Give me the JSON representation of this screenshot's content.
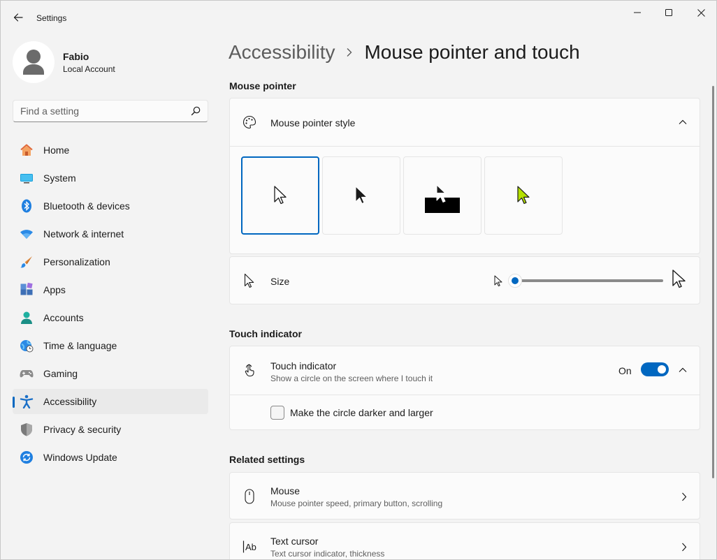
{
  "app": {
    "title": "Settings"
  },
  "profile": {
    "name": "Fabio",
    "account_type": "Local Account"
  },
  "search": {
    "placeholder": "Find a setting"
  },
  "sidebar": {
    "items": [
      {
        "label": "Home",
        "icon": "home-icon"
      },
      {
        "label": "System",
        "icon": "system-icon"
      },
      {
        "label": "Bluetooth & devices",
        "icon": "bluetooth-icon"
      },
      {
        "label": "Network & internet",
        "icon": "wifi-icon"
      },
      {
        "label": "Personalization",
        "icon": "brush-icon"
      },
      {
        "label": "Apps",
        "icon": "apps-icon"
      },
      {
        "label": "Accounts",
        "icon": "accounts-icon"
      },
      {
        "label": "Time & language",
        "icon": "globe-clock-icon"
      },
      {
        "label": "Gaming",
        "icon": "gamepad-icon"
      },
      {
        "label": "Accessibility",
        "icon": "accessibility-icon",
        "selected": true
      },
      {
        "label": "Privacy & security",
        "icon": "shield-icon"
      },
      {
        "label": "Windows Update",
        "icon": "update-icon"
      }
    ]
  },
  "breadcrumb": {
    "parent": "Accessibility",
    "current": "Mouse pointer and touch"
  },
  "mouse_pointer": {
    "section_title": "Mouse pointer",
    "style": {
      "title": "Mouse pointer style",
      "options": [
        "white",
        "black",
        "inverted",
        "custom"
      ],
      "selected": "white",
      "custom_color": "#b4e000"
    },
    "size": {
      "title": "Size",
      "value": 1,
      "min": 1,
      "max": 15
    }
  },
  "touch_indicator": {
    "section_title": "Touch indicator",
    "title": "Touch indicator",
    "subtitle": "Show a circle on the screen where I touch it",
    "state_label": "On",
    "enabled": true,
    "option_label": "Make the circle darker and larger",
    "option_checked": false
  },
  "related": {
    "section_title": "Related settings",
    "items": [
      {
        "title": "Mouse",
        "subtitle": "Mouse pointer speed, primary button, scrolling",
        "icon": "mouse-icon"
      },
      {
        "title": "Text cursor",
        "subtitle": "Text cursor indicator, thickness",
        "icon": "text-cursor-icon"
      }
    ]
  },
  "colors": {
    "accent": "#0067c0",
    "background": "#f3f3f3",
    "card": "#fbfbfb"
  }
}
